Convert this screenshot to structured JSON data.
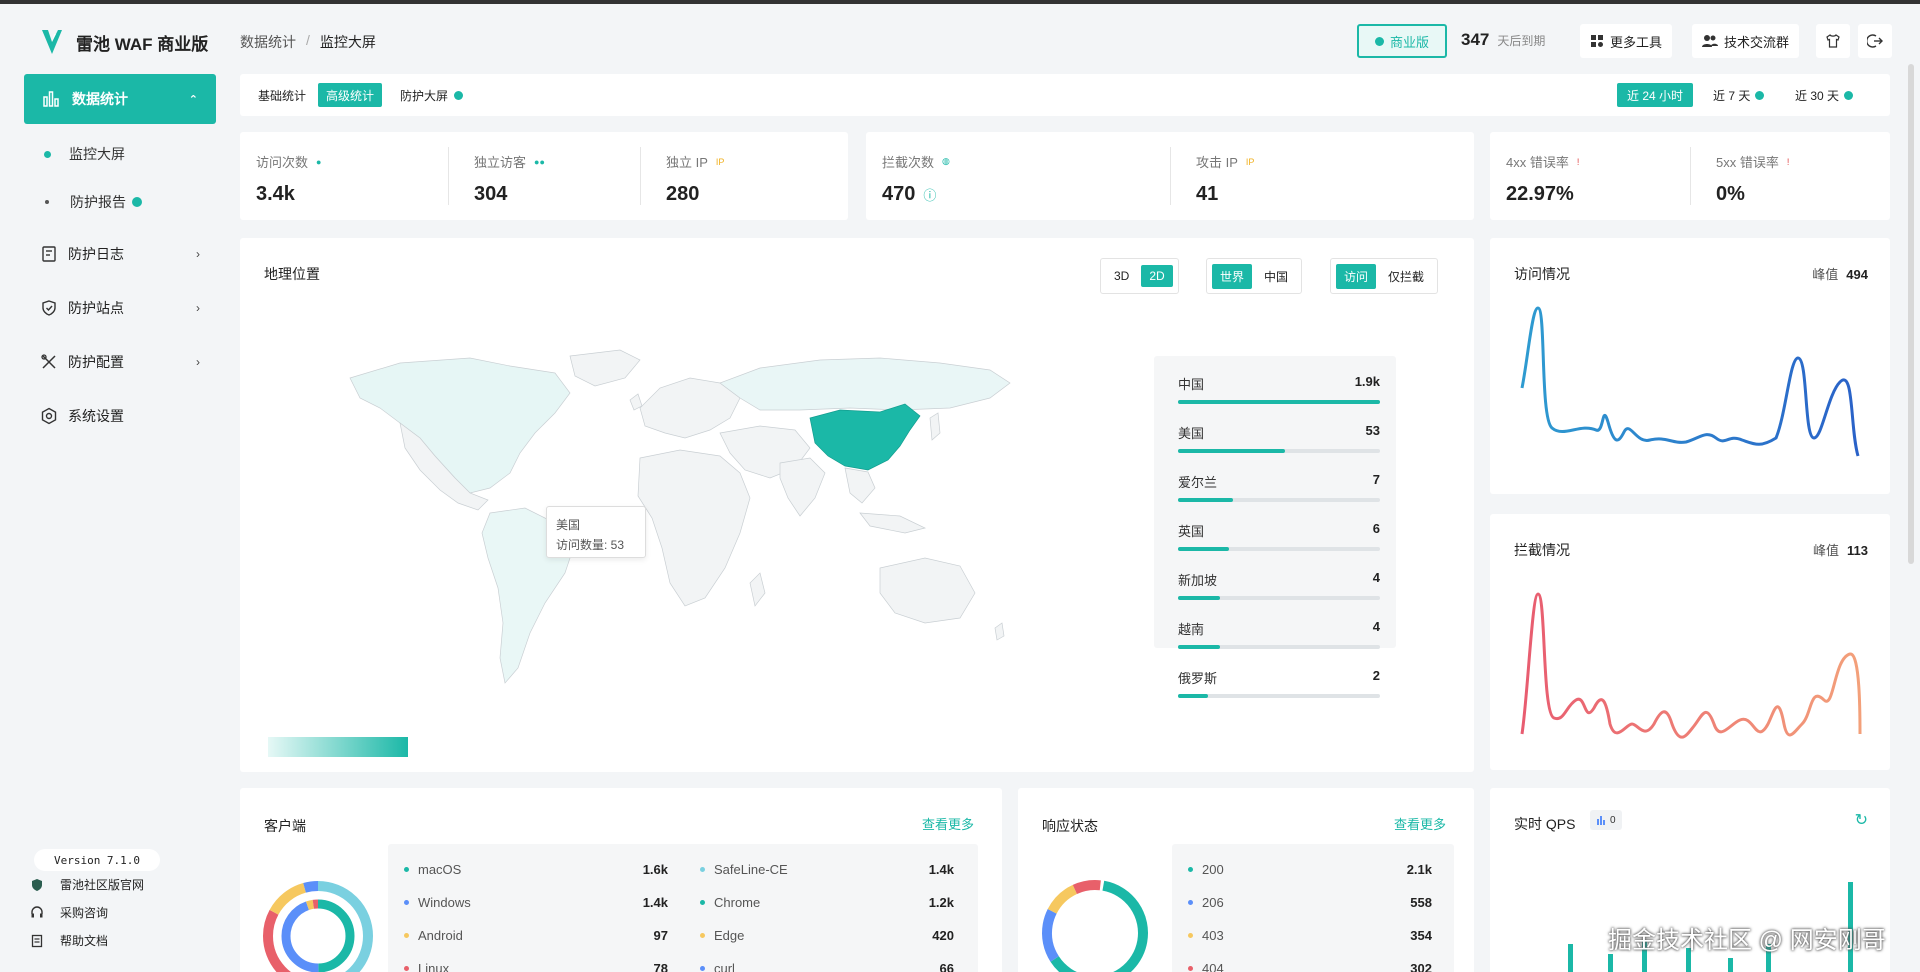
{
  "app": {
    "name": "雷池 WAF 商业版"
  },
  "breadcrumb": {
    "parent": "数据统计",
    "separator": "/",
    "current": "监控大屏"
  },
  "header": {
    "edition_badge": "商业版",
    "days_left": "347",
    "days_left_label": "天后到期",
    "more_tools": "更多工具",
    "community": "技术交流群"
  },
  "sidebar": {
    "active_group": "数据统计",
    "sub_items": [
      {
        "label": "监控大屏"
      },
      {
        "label": "防护报告"
      }
    ],
    "items": [
      {
        "label": "防护日志",
        "icon": "log-icon"
      },
      {
        "label": "防护站点",
        "icon": "shield-icon"
      },
      {
        "label": "防护配置",
        "icon": "tools-icon"
      },
      {
        "label": "系统设置",
        "icon": "gear-icon"
      }
    ],
    "version": "Version 7.1.0",
    "footer_links": [
      {
        "label": "雷池社区版官网",
        "icon": "shield-small-icon"
      },
      {
        "label": "采购咨询",
        "icon": "headset-icon"
      },
      {
        "label": "帮助文档",
        "icon": "doc-icon"
      }
    ]
  },
  "tabs": {
    "items": [
      "基础统计",
      "高级统计",
      "防护大屏"
    ],
    "active": "高级统计"
  },
  "ranges": {
    "items": [
      "近 24 小时",
      "近 7 天",
      "近 30 天"
    ],
    "active": "近 24 小时"
  },
  "stats": {
    "visits": {
      "label": "访问次数",
      "value": "3.4k"
    },
    "unique_visitors": {
      "label": "独立访客",
      "value": "304"
    },
    "unique_ip": {
      "label": "独立 IP",
      "value": "280"
    },
    "blocks": {
      "label": "拦截次数",
      "value": "470"
    },
    "attack_ip": {
      "label": "攻击 IP",
      "value": "41"
    },
    "err4xx": {
      "label": "4xx 错误率",
      "value": "22.97%"
    },
    "err5xx": {
      "label": "5xx 错误率",
      "value": "0%"
    }
  },
  "geo": {
    "title": "地理位置",
    "view_modes": [
      "3D",
      "2D"
    ],
    "view_active": "2D",
    "scope": [
      "世界",
      "中国"
    ],
    "scope_active": "世界",
    "filter": [
      "访问",
      "仅拦截"
    ],
    "filter_active": "访问",
    "tooltip": {
      "country": "美国",
      "text": "访问数量: 53"
    },
    "ranking": [
      {
        "name": "中国",
        "count": "1.9k",
        "ratio": 1.0
      },
      {
        "name": "美国",
        "count": "53",
        "ratio": 0.53
      },
      {
        "name": "爱尔兰",
        "count": "7",
        "ratio": 0.27
      },
      {
        "name": "英国",
        "count": "6",
        "ratio": 0.25
      },
      {
        "name": "新加坡",
        "count": "4",
        "ratio": 0.21
      },
      {
        "name": "越南",
        "count": "4",
        "ratio": 0.21
      },
      {
        "name": "俄罗斯",
        "count": "2",
        "ratio": 0.15
      }
    ]
  },
  "visits_chart": {
    "title": "访问情况",
    "peak_label": "峰值",
    "peak": "494",
    "color": "#2a7bc8"
  },
  "blocks_chart": {
    "title": "拦截情况",
    "peak_label": "峰值",
    "peak": "113",
    "color": "#e8606a"
  },
  "clients": {
    "title": "客户端",
    "more": "查看更多",
    "left": [
      {
        "name": "macOS",
        "value": "1.6k",
        "color": "#1bb8a7"
      },
      {
        "name": "Windows",
        "value": "1.4k",
        "color": "#5b8ff9"
      },
      {
        "name": "Android",
        "value": "97",
        "color": "#f6c85f"
      },
      {
        "name": "Linux",
        "value": "78",
        "color": "#e8606a"
      }
    ],
    "right": [
      {
        "name": "SafeLine-CE",
        "value": "1.4k",
        "color": "#7ad0e0"
      },
      {
        "name": "Chrome",
        "value": "1.2k",
        "color": "#1bb8a7"
      },
      {
        "name": "Edge",
        "value": "420",
        "color": "#f6c85f"
      },
      {
        "name": "curl",
        "value": "66",
        "color": "#5b8ff9"
      }
    ]
  },
  "responses": {
    "title": "响应状态",
    "more": "查看更多",
    "items": [
      {
        "name": "200",
        "value": "2.1k",
        "color": "#1bb8a7"
      },
      {
        "name": "206",
        "value": "558",
        "color": "#5b8ff9"
      },
      {
        "name": "403",
        "value": "354",
        "color": "#f6c85f"
      },
      {
        "name": "404",
        "value": "302",
        "color": "#e8606a"
      }
    ]
  },
  "qps": {
    "title": "实时 QPS",
    "value": "0"
  },
  "watermark": "掘金技术社区 @ 网安刚哥"
}
